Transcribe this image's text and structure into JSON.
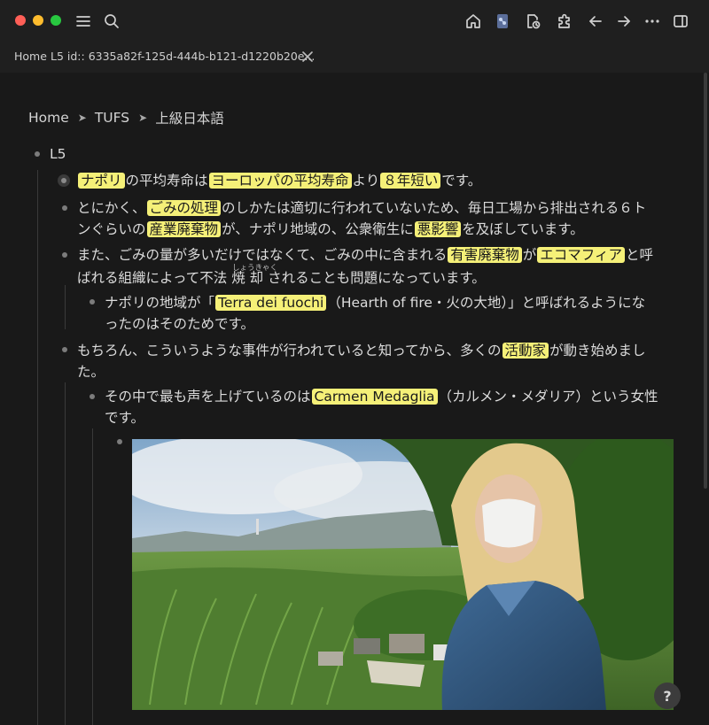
{
  "window": {
    "colors": {
      "close": "#ff5f57",
      "minimize": "#febc2e",
      "zoom": "#28c840",
      "highlight": "#f5f078"
    },
    "toolbar_icons": [
      "menu-icon",
      "search-icon",
      "home-icon",
      "graph-icon",
      "recent-icon",
      "plugin-icon",
      "back-icon",
      "forward-icon",
      "more-icon",
      "sidebar-icon"
    ]
  },
  "tab": {
    "home_label": "Home",
    "page_label": "L5 id:: 6335a82f-125d-444b-b121-d1220b20e..."
  },
  "breadcrumb": [
    "Home",
    "TUFS",
    "上級日本語"
  ],
  "page": {
    "root_block": "L5",
    "b1": {
      "s1": "ナポリ",
      "s2": "の平均寿命は",
      "s3": "ヨーロッパの平均寿命",
      "s4": "より",
      "s5": "８年短い",
      "s6": "です。"
    },
    "b2": {
      "l1a": "とにかく、",
      "l1b": "ごみの処理",
      "l1c": "のしかたは適切に行われていないため、毎日工場から排出される６ト",
      "l2a": "ンぐらいの",
      "l2b": "産業廃棄物",
      "l2c": "が、ナポリ地域の、公衆衛生に",
      "l2d": "悪影響",
      "l2e": "を及ぼしています。"
    },
    "b3": {
      "l1a": "また、ごみの量が多いだけではなくて、ごみの中に含まれる",
      "l1b": "有害廃棄物",
      "l1c": "が",
      "l1d": "エコマフィア",
      "l1e": "と呼",
      "l2a": "ばれる組織によって不法",
      "l2b": "焼",
      "l2c": "却",
      "l2d": "されることも問題になっています。",
      "ruby": "しょうきゃく"
    },
    "b4": {
      "l1a": "ナポリの地域が「",
      "l1b": "Terra dei fuochi",
      "l1c": "（Hearth of fire・火の大地）」と呼ばれるようにな",
      "l2": "ったのはそのためです。"
    },
    "b5": {
      "l1a": "もちろん、こういうような事件が行われていると知ってから、多くの",
      "l1b": "活動家",
      "l1c": "が動き始めまし",
      "l2": "た。"
    },
    "b6": {
      "l1a": "その中で最も声を上げているのは",
      "l1b": "Carmen Medaglia",
      "l1c": "（カルメン・メダリア）という女性",
      "l2": "です。"
    }
  },
  "help_label": "?"
}
